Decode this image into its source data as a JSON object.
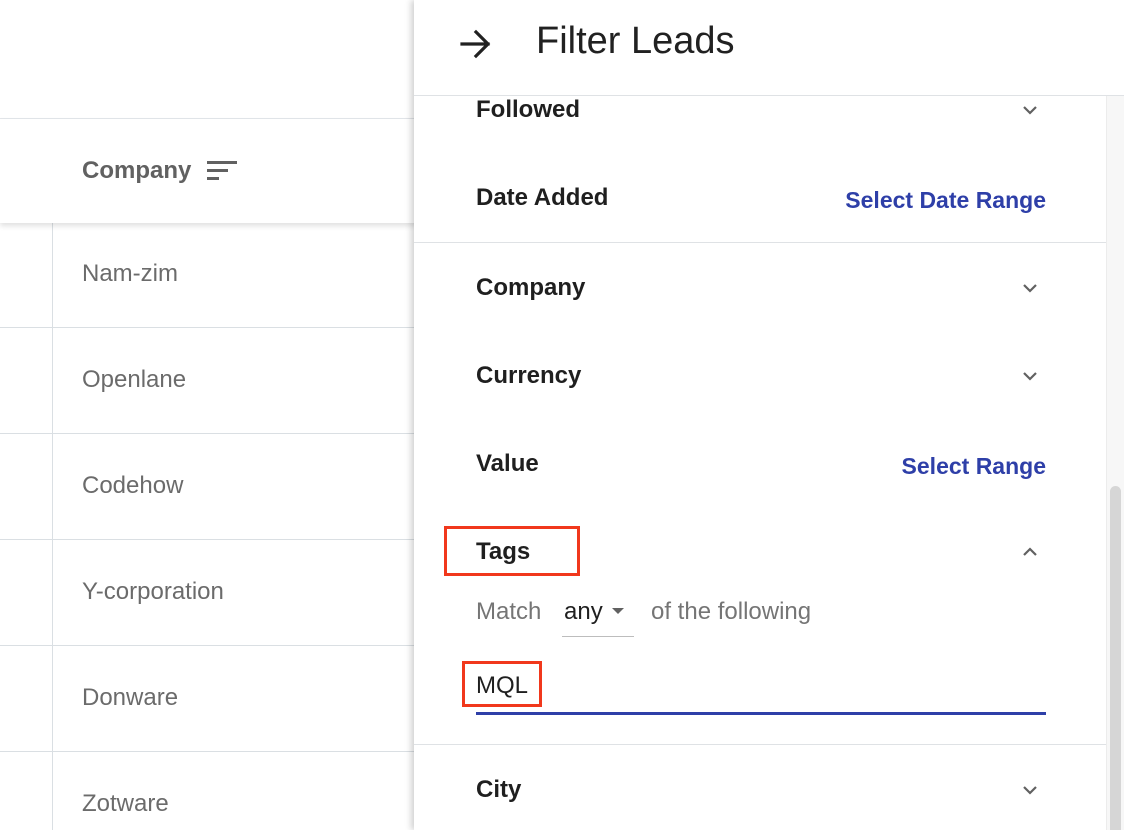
{
  "table": {
    "column_header": "Company",
    "rows": [
      "Nam-zim",
      "Openlane",
      "Codehow",
      "Y-corporation",
      "Donware",
      "Zotware"
    ]
  },
  "panel": {
    "title": "Filter Leads",
    "filters": {
      "followed": "Followed",
      "date_added": "Date Added",
      "date_range_link": "Select Date Range",
      "company": "Company",
      "currency": "Currency",
      "value": "Value",
      "value_range_link": "Select Range",
      "tags": "Tags",
      "city": "City"
    },
    "tags_section": {
      "match_prefix": "Match",
      "match_value": "any",
      "match_suffix": "of the following",
      "input_value": "MQL"
    }
  },
  "colors": {
    "accent": "#2e3fa8",
    "highlight": "#f1381c"
  },
  "icons": {
    "back": "arrow-right-icon",
    "sort": "sort-icon",
    "expand": "chevron-down-icon",
    "collapse": "chevron-up-icon"
  }
}
